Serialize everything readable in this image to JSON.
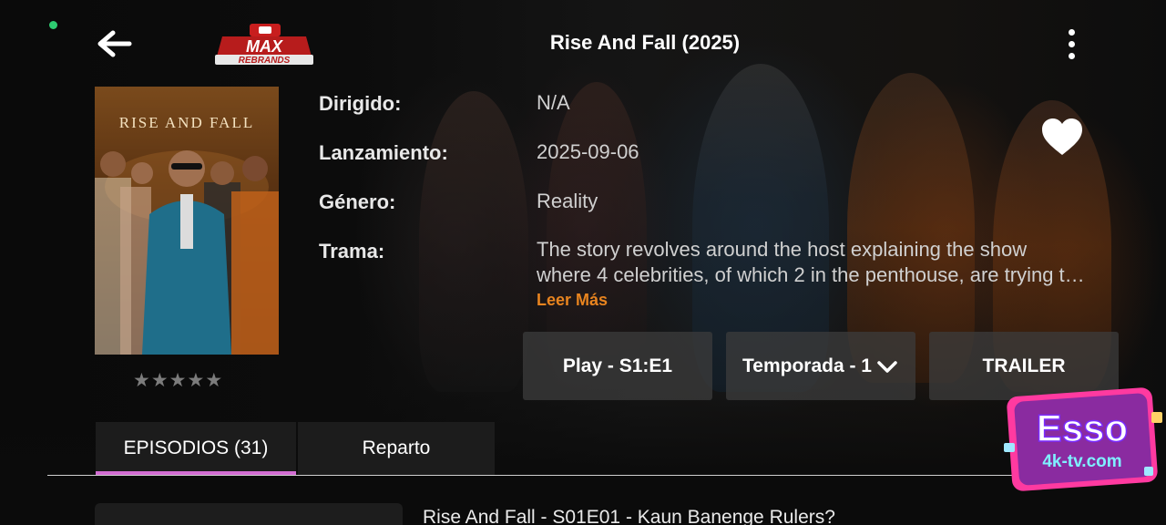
{
  "header": {
    "title": "Rise And Fall (2025)",
    "logo_text": "MAX",
    "logo_subtext": "REBRANDS",
    "back_icon": "arrow-left-icon",
    "menu_icon": "more-vertical-icon"
  },
  "poster": {
    "title_text": "RISE AND FALL"
  },
  "rating": {
    "stars_filled": 0,
    "stars_total": 5,
    "star_color": "#7c7c7c"
  },
  "details": {
    "director_label": "Dirigido:",
    "director_value": "N/A",
    "release_label": "Lanzamiento:",
    "release_value": "2025-09-06",
    "genre_label": "Género:",
    "genre_value": "Reality",
    "plot_label": "Trama:",
    "plot_line1": "The story revolves around the host explaining the show",
    "plot_line2": "where 4 celebrities, of which 2 in the penthouse, are trying t…",
    "read_more": "Leer Más"
  },
  "favorite_icon": "heart-icon",
  "actions": {
    "play": "Play - S1:E1",
    "season": "Temporada - 1",
    "trailer": "TRAILER"
  },
  "tabs": {
    "episodes": "EPISODIOS (31)",
    "cast": "Reparto",
    "active_color": "#d36dd3"
  },
  "episodes": [
    {
      "title": "Rise And Fall - S01E01 - Kaun Banenge Rulers?"
    }
  ],
  "watermark": {
    "brand": "Esso",
    "site": "4k-tv.com"
  },
  "colors": {
    "accent_orange": "#e8841f",
    "status_green": "#2ecc71",
    "button_bg": "#3c3c3c"
  }
}
